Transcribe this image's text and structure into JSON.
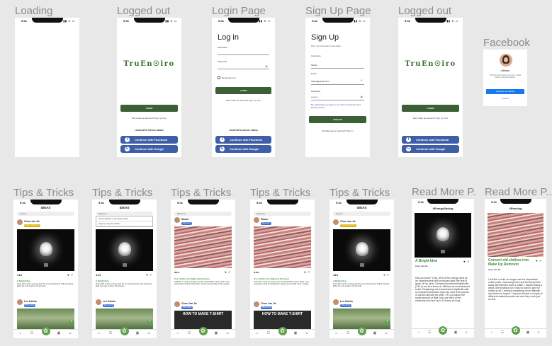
{
  "frames": {
    "loading": "Loading",
    "logged_out_1": "Logged out",
    "login": "Login Page",
    "signup": "Sign Up Page",
    "logged_out_2": "Logged out",
    "facebook": "Facebook",
    "tips_1": "Tips & Tricks ...",
    "tips_2": "Tips & Tricks ...",
    "tips_3": "Tips & Tricks ...",
    "tips_4": "Tips & Tricks ...",
    "tips_5": "Tips & Tricks ...",
    "read_more_1": "Read More P...",
    "read_more_2": "Read More P..."
  },
  "status": {
    "time": "9:41",
    "icons": "▮▮ ≋ ▭"
  },
  "app": {
    "logo": "TruEn☉iro"
  },
  "auth": {
    "login_btn": "LOGIN",
    "no_account": "Don't have an account?",
    "sign_up_here": "Sign up here",
    "social_header": "LOGIN WITH SOCIAL MEDIA",
    "facebook_btn": "Continue with Facebook",
    "google_btn": "Continue with Google",
    "facebook_glyph": "f",
    "google_glyph": "G"
  },
  "login": {
    "title": "Log in",
    "username_label": "Username",
    "password_label": "Password",
    "remember": "Remember me"
  },
  "signup": {
    "title": "Sign Up",
    "subtitle": "Fill in the necessary credentials",
    "username_label": "Username",
    "username_value": "Sbean",
    "email_label": "Email",
    "email_value": "Sbean@gmail.com",
    "password_label": "Password",
    "password_value": "•••••••••",
    "terms": "By continuing you agree to our Terms of Service and Privacy Policy",
    "signup_btn": "SIGN UP",
    "already": "Already have an account?",
    "sign_in": "Sign in"
  },
  "facebook_dialog": {
    "name": "Lilbean",
    "description": "TruEnviro will receive your name, profile picture and email address.",
    "continue_btn": "Continue as Lilbean",
    "cancel": "Cancel"
  },
  "feed": {
    "header": "IDEAS",
    "search_placeholder": "Search",
    "search_typed": "#Reduce",
    "search_suggestions": [
      "reuse clothes in annoying cuts)",
      "ways to recycle clothes"
    ],
    "author_1": "Choo Jun Jie",
    "badge_1": "Green Influencer",
    "author_2": "Sbean",
    "badge_2": "#Reusing",
    "title_bulb": "A Bright Idea",
    "title_clothes": "Use clothes into Make Up Remover",
    "body_bulb": "Only 10% of the energy used by an incandescent bulb produces light, the rest is given off as heat.",
    "body_clothes": "I felt like I could no longer use the disposable cotton pads. Just using them and throwing them away seemed like such a waste.",
    "read_more": "read more",
    "author_3": "Lee Kahho",
    "badge_3": "#Recycling",
    "shirt_text": "HOW TO MAKE T-SHIRT",
    "like_icon": "♥",
    "share_icon": "↗",
    "comment_icon": "…",
    "plus": "+"
  },
  "read_more_1": {
    "tag": "#EnergySaving",
    "title": "A Bright Idea",
    "author": "Choo Jun Jie",
    "body": "Did you know? Only 10% of the energy used by an incandescent bulb produces light; the rest is given off as heat. Compact fluorescent lightbulbs (CFLs) are four times as efficient as incandescent bulbs. Replacing one incandescent lightbulb with a compact fluorescent light can save 150 pounds of carbon dioxide per year. CFLs produce the same amount of light, use one third of the electricity and last up to 10 times as long."
  },
  "read_more_2": {
    "tag": "#Reusing",
    "title": "Convert old clothes into Make Up Remover",
    "author": "Choo Jun Jie",
    "body": "I felt like I could no longer use the disposable cotton pads. Just using them and throwing them away seemed like such a waste. I started using a wash cloth instead but it was so hard to get my make up off. I needed something more delicate, and where to begin? I had just thrown a couple of different material people use and they work just as fine."
  }
}
